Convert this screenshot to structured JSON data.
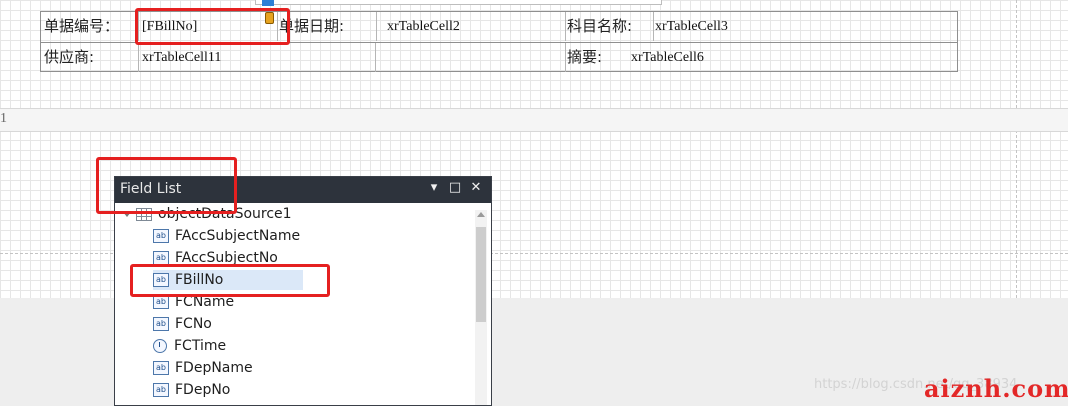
{
  "report_table": {
    "row1": {
      "label1": "单据编号：",
      "bound_field": "[FBillNo]",
      "label2": "单据日期:",
      "cell2": "xrTableCell2",
      "label3": "科目名称:",
      "cell3": "xrTableCell3"
    },
    "row2": {
      "label1": "供应商:",
      "cell11": "xrTableCell11",
      "label3": "摘要:",
      "cell6": "xrTableCell6"
    }
  },
  "band_marker": "1",
  "field_list": {
    "title": "Field List",
    "controls": {
      "dropdown": "▾",
      "maximize": "□",
      "close": "✕"
    },
    "datasource": "objectDataSource1",
    "fields": [
      {
        "label": "FAccSubjectName",
        "icon": "string-field-icon",
        "selected": false
      },
      {
        "label": "FAccSubjectNo",
        "icon": "string-field-icon",
        "selected": false
      },
      {
        "label": "FBillNo",
        "icon": "string-field-icon",
        "selected": true
      },
      {
        "label": "FCName",
        "icon": "string-field-icon",
        "selected": false
      },
      {
        "label": "FCNo",
        "icon": "string-field-icon",
        "selected": false
      },
      {
        "label": "FCTime",
        "icon": "datetime-field-icon",
        "selected": false
      },
      {
        "label": "FDepName",
        "icon": "string-field-icon",
        "selected": false
      },
      {
        "label": "FDepNo",
        "icon": "string-field-icon",
        "selected": false
      }
    ]
  },
  "watermark": {
    "url": "https://blog.csdn.net/qq_38934",
    "site": "aiznh.com"
  },
  "colors": {
    "highlight": "#e52020",
    "panel_title": "#2d333c",
    "selection": "#dbe8f8"
  }
}
